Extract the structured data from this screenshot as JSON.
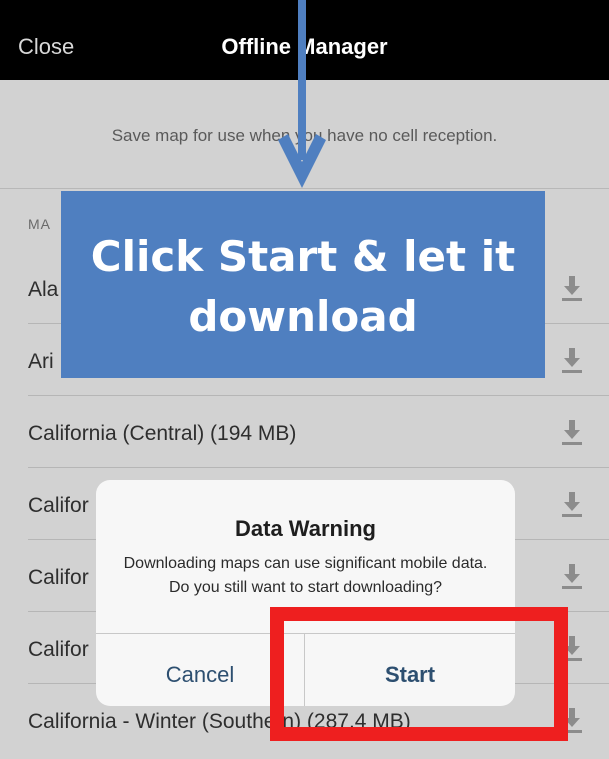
{
  "header": {
    "close_label": "Close",
    "title": "Offline Manager"
  },
  "info_text": "Save map for use when you have no cell reception.",
  "section_header": "MA",
  "maps": [
    {
      "label": "Ala"
    },
    {
      "label": "Ari"
    },
    {
      "label": "California (Central) (194 MB)"
    },
    {
      "label": "Califor"
    },
    {
      "label": "Califor"
    },
    {
      "label": "Califor"
    },
    {
      "label": "California - Winter (Southern) (287.4 MB)"
    }
  ],
  "callout": {
    "line1": "Click Start & let it",
    "line2": "download"
  },
  "dialog": {
    "title": "Data Warning",
    "message": "Downloading maps can use significant mobile data. Do you still want to start downloading?",
    "cancel_label": "Cancel",
    "start_label": "Start"
  },
  "colors": {
    "callout": "#4f7fc0",
    "highlight": "#ee1f1f",
    "button_text": "#2d4f70"
  },
  "icons": {
    "row_action": "download-icon",
    "annotation": "down-arrow"
  }
}
